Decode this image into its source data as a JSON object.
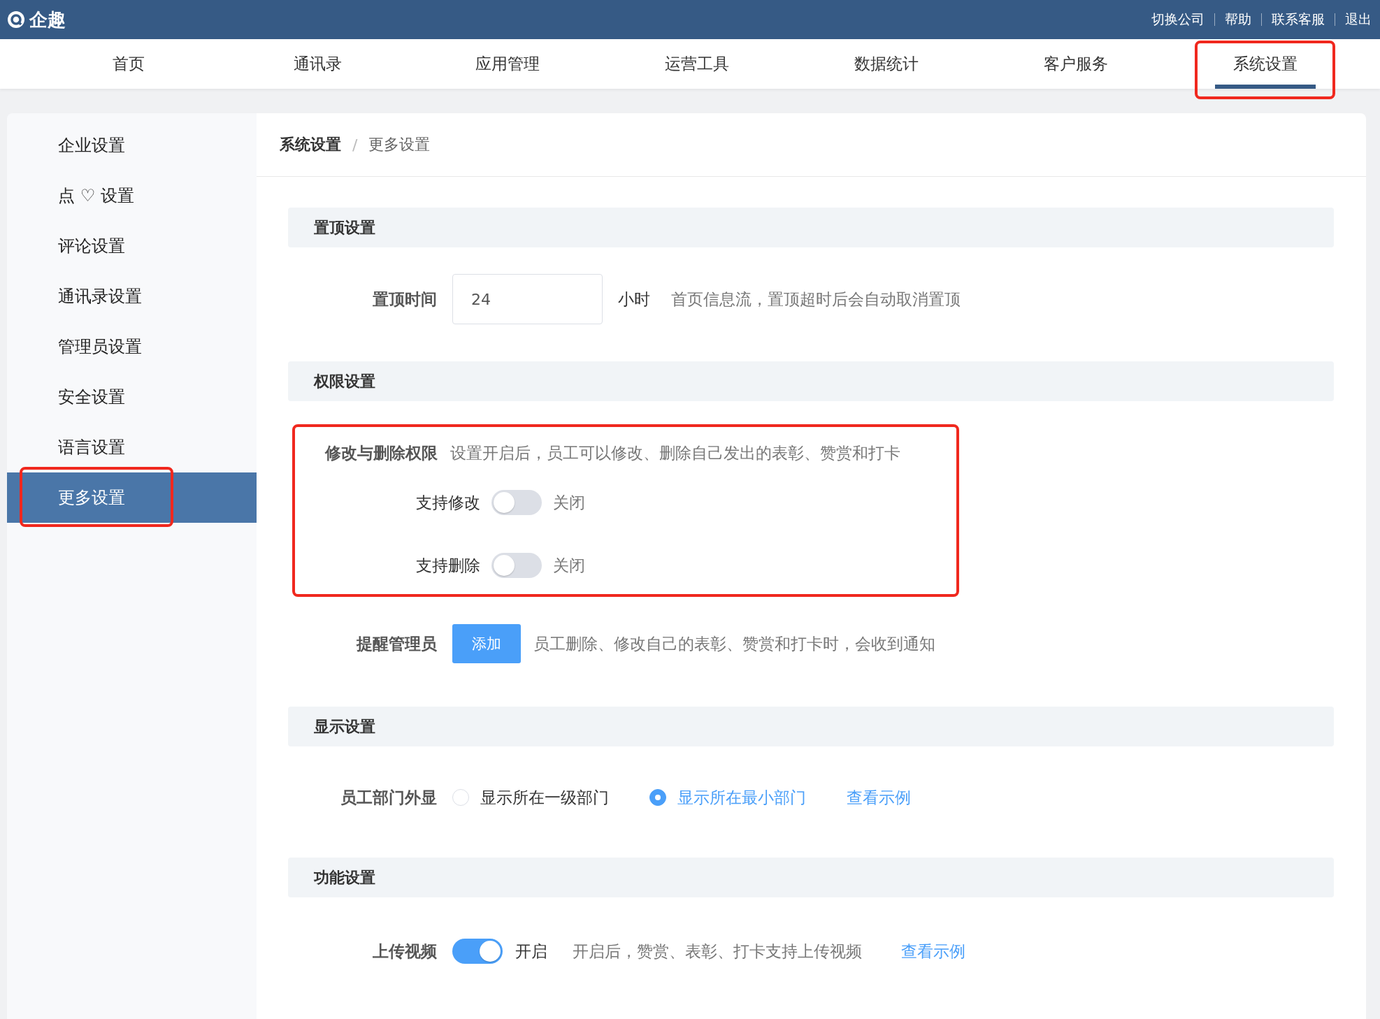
{
  "header": {
    "logo": "企趣",
    "links": [
      "切换公司",
      "帮助",
      "联系客服",
      "退出"
    ]
  },
  "nav": [
    {
      "label": "首页",
      "selected": false,
      "highlighted": false
    },
    {
      "label": "通讯录",
      "selected": false,
      "highlighted": false
    },
    {
      "label": "应用管理",
      "selected": false,
      "highlighted": false
    },
    {
      "label": "运营工具",
      "selected": false,
      "highlighted": false
    },
    {
      "label": "数据统计",
      "selected": false,
      "highlighted": false
    },
    {
      "label": "客户服务",
      "selected": false,
      "highlighted": false
    },
    {
      "label": "系统设置",
      "selected": true,
      "highlighted": true
    }
  ],
  "sidebar": {
    "items": [
      {
        "label": "企业设置",
        "selected": false,
        "highlighted": false
      },
      {
        "label": "点 ♡ 设置",
        "selected": false,
        "highlighted": false
      },
      {
        "label": "评论设置",
        "selected": false,
        "highlighted": false
      },
      {
        "label": "通讯录设置",
        "selected": false,
        "highlighted": false
      },
      {
        "label": "管理员设置",
        "selected": false,
        "highlighted": false
      },
      {
        "label": "安全设置",
        "selected": false,
        "highlighted": false
      },
      {
        "label": "语言设置",
        "selected": false,
        "highlighted": false
      },
      {
        "label": "更多设置",
        "selected": true,
        "highlighted": true
      }
    ]
  },
  "breadcrumb": {
    "items": [
      "系统设置",
      "更多设置"
    ],
    "separator": "/"
  },
  "sections": [
    {
      "title": "置顶设置",
      "rows": [
        {
          "kind": "input",
          "label": "置顶时间",
          "value": "24",
          "unit": "小时",
          "hint": "首页信息流，置顶超时后会自动取消置顶"
        }
      ]
    },
    {
      "title": "权限设置",
      "rows": [
        {
          "kind": "permission",
          "highlighted": true,
          "label": "修改与删除权限",
          "hint": "设置开启后，员工可以修改、删除自己发出的表彰、赞赏和打卡",
          "toggles": [
            {
              "label": "支持修改",
              "on": false,
              "state_text": "关闭"
            },
            {
              "label": "支持删除",
              "on": false,
              "state_text": "关闭"
            }
          ]
        },
        {
          "kind": "button",
          "label": "提醒管理员",
          "button": "添加",
          "hint": "员工删除、修改自己的表彰、赞赏和打卡时，会收到通知"
        }
      ]
    },
    {
      "title": "显示设置",
      "rows": [
        {
          "kind": "radio",
          "label": "员工部门外显",
          "options": [
            {
              "label": "显示所在一级部门",
              "selected": false
            },
            {
              "label": "显示所在最小部门",
              "selected": true
            }
          ],
          "link": "查看示例"
        }
      ]
    },
    {
      "title": "功能设置",
      "rows": [
        {
          "kind": "toggle",
          "label": "上传视频",
          "on": true,
          "state_text": "开启",
          "hint": "开启后，赞赏、表彰、打卡支持上传视频",
          "link": "查看示例"
        }
      ]
    }
  ]
}
